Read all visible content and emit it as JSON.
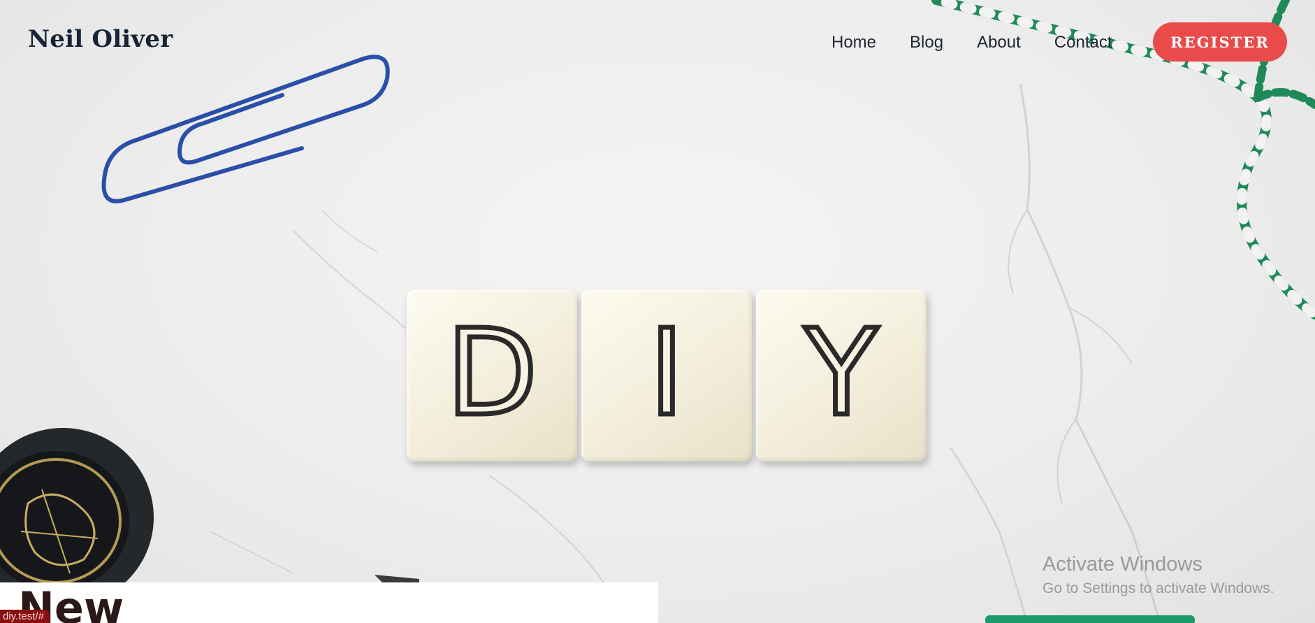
{
  "header": {
    "site_title": "Neil Oliver",
    "nav": [
      {
        "label": "Home"
      },
      {
        "label": "Blog"
      },
      {
        "label": "About"
      },
      {
        "label": "Contact"
      }
    ],
    "register_label": "REGISTER"
  },
  "hero": {
    "tiles": [
      "D",
      "I",
      "Y"
    ]
  },
  "post_card": {
    "title": "New"
  },
  "status_bar": {
    "url": "diy.test/#"
  },
  "watermark": {
    "title": "Activate Windows",
    "subtitle": "Go to Settings to activate Windows."
  },
  "colors": {
    "brand_dark": "#172436",
    "register_bg": "#e94b4b",
    "register_text": "#ffffff",
    "status_bg": "#8b0e0e"
  },
  "icons": [
    "paperclip-decoration",
    "twine-decoration",
    "wax-seal-decoration"
  ]
}
